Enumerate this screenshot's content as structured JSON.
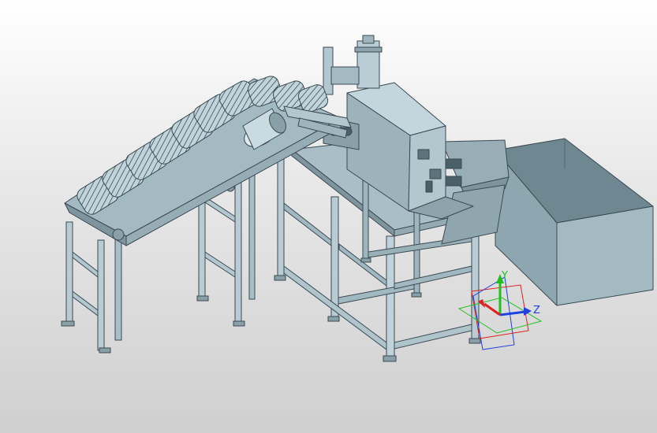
{
  "viewport": {
    "background_top": "#ffffff",
    "background_bottom": "#cfcfcf",
    "part_color": "#a9c0c9",
    "part_shadow": "#7d939c",
    "part_light": "#c6d8df",
    "edge_color": "#3b4a52"
  },
  "triad": {
    "x_label": "",
    "y_label": "Y",
    "z_label": "Z",
    "x_color": "#e02020",
    "y_color": "#20c020",
    "z_color": "#2040e0"
  }
}
